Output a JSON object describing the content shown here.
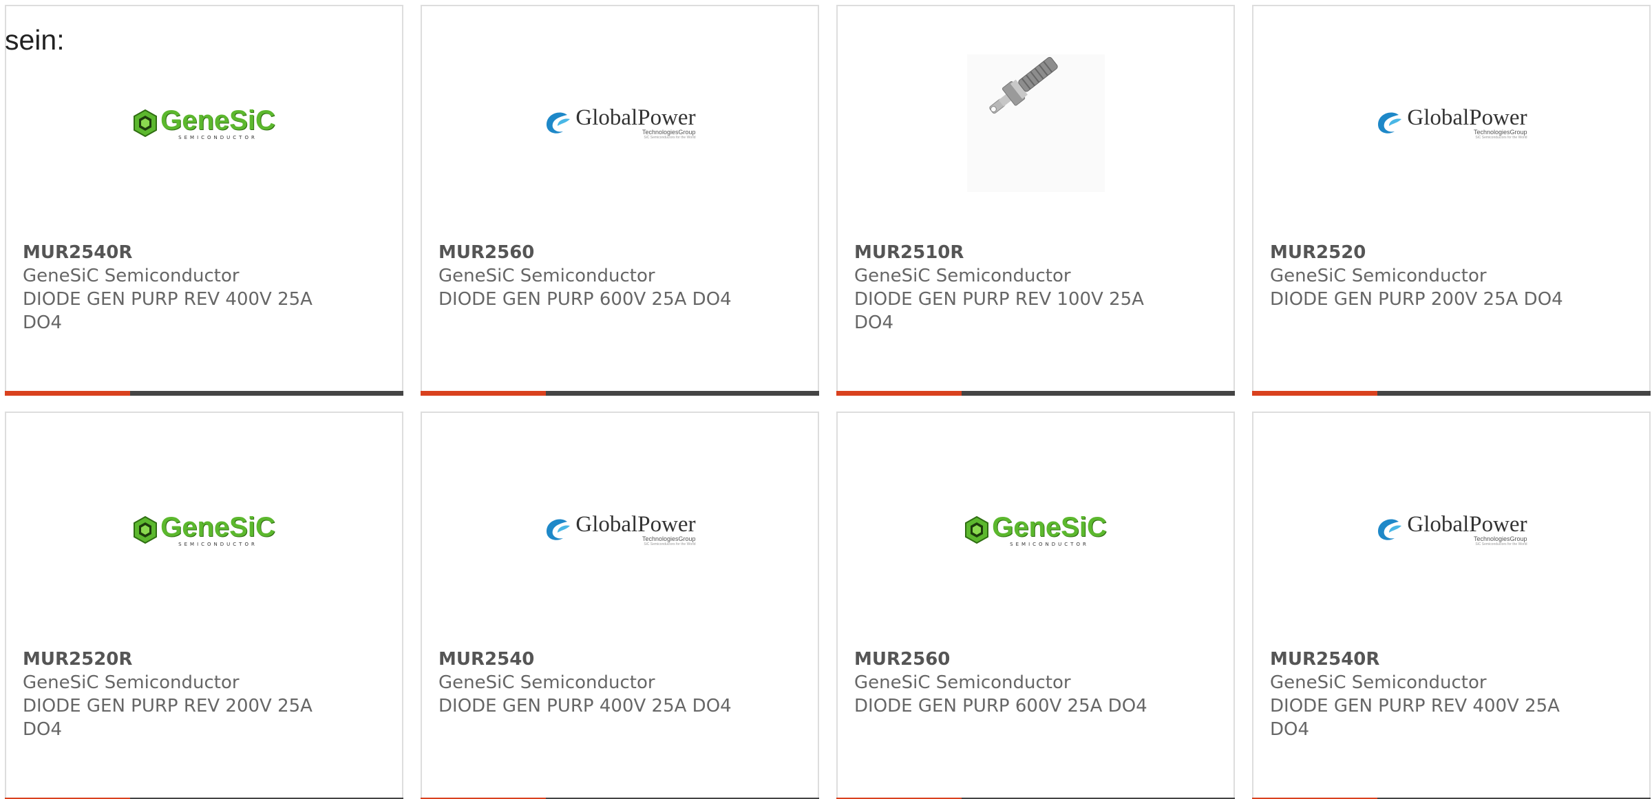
{
  "intro_text": "sein:",
  "products": [
    {
      "part": "MUR2540R",
      "manufacturer": "GeneSiC Semiconductor",
      "description": "DIODE GEN PURP REV 400V 25A DO4",
      "image": "genesic-logo"
    },
    {
      "part": "MUR2560",
      "manufacturer": "GeneSiC Semiconductor",
      "description": "DIODE GEN PURP 600V 25A DO4",
      "image": "globalpower-logo"
    },
    {
      "part": "MUR2510R",
      "manufacturer": "GeneSiC Semiconductor",
      "description": "DIODE GEN PURP REV 100V 25A DO4",
      "image": "stud-diode-photo"
    },
    {
      "part": "MUR2520",
      "manufacturer": "GeneSiC Semiconductor",
      "description": "DIODE GEN PURP 200V 25A DO4",
      "image": "globalpower-logo"
    },
    {
      "part": "MUR2520R",
      "manufacturer": "GeneSiC Semiconductor",
      "description": "DIODE GEN PURP REV 200V 25A DO4",
      "image": "genesic-logo"
    },
    {
      "part": "MUR2540",
      "manufacturer": "GeneSiC Semiconductor",
      "description": "DIODE GEN PURP 400V 25A DO4",
      "image": "globalpower-logo"
    },
    {
      "part": "MUR2560",
      "manufacturer": "GeneSiC Semiconductor",
      "description": "DIODE GEN PURP 600V 25A DO4",
      "image": "genesic-logo"
    },
    {
      "part": "MUR2540R",
      "manufacturer": "GeneSiC Semiconductor",
      "description": "DIODE GEN PURP REV 400V 25A DO4",
      "image": "globalpower-logo"
    }
  ],
  "logos": {
    "genesic": {
      "name": "GeneSiC",
      "sub": "SEMICONDUCTOR"
    },
    "globalpower": {
      "name": "GlobalPower",
      "sub": "TechnologiesGroup",
      "tag": "SiC Semiconductors for the World"
    }
  },
  "colors": {
    "accent": "#d9411e",
    "bar": "#444444",
    "genesic_green": "#5cb82e",
    "globalpower_blue": "#1e88c8"
  }
}
